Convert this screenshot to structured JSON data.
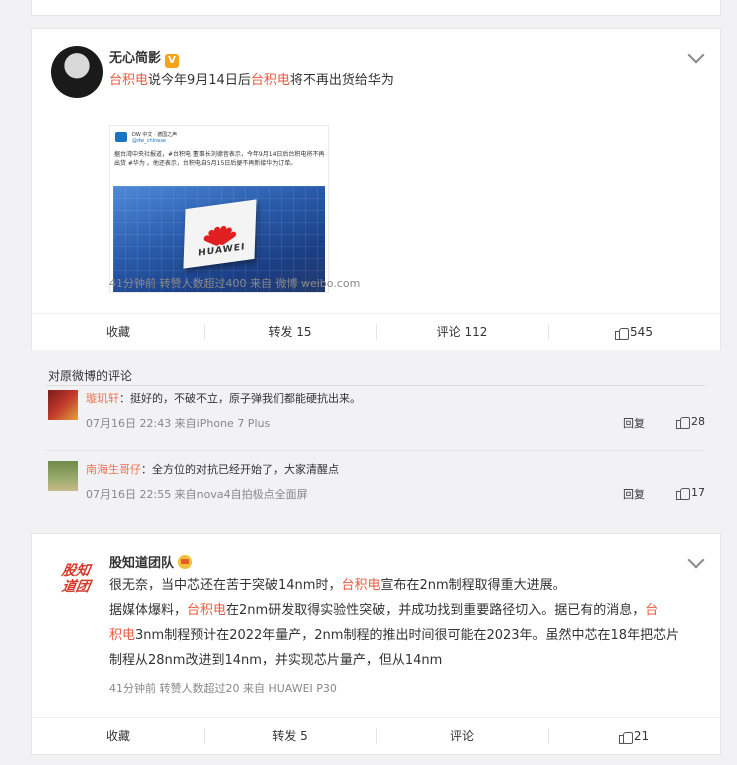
{
  "post1": {
    "author": "无心简影",
    "badge": "V",
    "text_parts": [
      {
        "t": "台积电",
        "hl": true
      },
      {
        "t": "说今年9月14日后",
        "hl": false
      },
      {
        "t": "台积电",
        "hl": true
      },
      {
        "t": "将不再出货给华为",
        "hl": false
      }
    ],
    "image": {
      "source": "DW 中文 · 德国之声",
      "handle": "@dw_chinese",
      "caption": "据台湾中央社报道，#台积电 董事长刘德音表示，今年9月14日后台积电将不再出货 #华为 。他还表示，台积电自5月15日后便不再新接华为订单。",
      "chip_text": "HUAWEI"
    },
    "meta": "41分钟前  转赞人数超过400  来自 微博 weibo.com",
    "actions": [
      "收藏",
      "转发 15",
      "评论 112",
      "545"
    ]
  },
  "comments": {
    "title": "对原微博的评论",
    "items": [
      {
        "name": "璇玑轩",
        "text": "：挺好的，不破不立，原子弹我们都能硬抗出来。",
        "meta": "07月16日 22:43 来自iPhone 7 Plus",
        "reply": "回复",
        "likes": "28"
      },
      {
        "name": "南海生哥仔",
        "text": "：全方位的对抗已经开始了，大家清醒点",
        "meta": "07月16日 22:55 来自nova4自拍极点全面屏",
        "reply": "回复",
        "likes": "17"
      }
    ]
  },
  "post2": {
    "author": "股知道团队",
    "logo_text": [
      "股知",
      "道团"
    ],
    "lines": [
      [
        {
          "t": "很无奈，当中芯还在苦于突破14nm时，",
          "hl": false
        },
        {
          "t": "台积电",
          "hl": true
        },
        {
          "t": "宣布在2nm制程取得重大进展。",
          "hl": false
        }
      ],
      [
        {
          "t": "据媒体爆料，",
          "hl": false
        },
        {
          "t": "台积电",
          "hl": true
        },
        {
          "t": "在2nm研发取得实验性突破，并成功找到重要路径切入。据已有的消息，",
          "hl": false
        },
        {
          "t": "台",
          "hl": true
        }
      ],
      [
        {
          "t": "积电",
          "hl": true
        },
        {
          "t": "3nm制程预计在2022年量产，2nm制程的推出时间很可能在2023年。虽然中芯在18年把芯片",
          "hl": false
        }
      ],
      [
        {
          "t": "制程从28nm改进到14nm，并实现芯片量产，但从14nm",
          "hl": false
        }
      ]
    ],
    "meta": "41分钟前  转赞人数超过20  来自 HUAWEI P30",
    "actions": [
      "收藏",
      "转发 5",
      "评论",
      "21"
    ]
  }
}
